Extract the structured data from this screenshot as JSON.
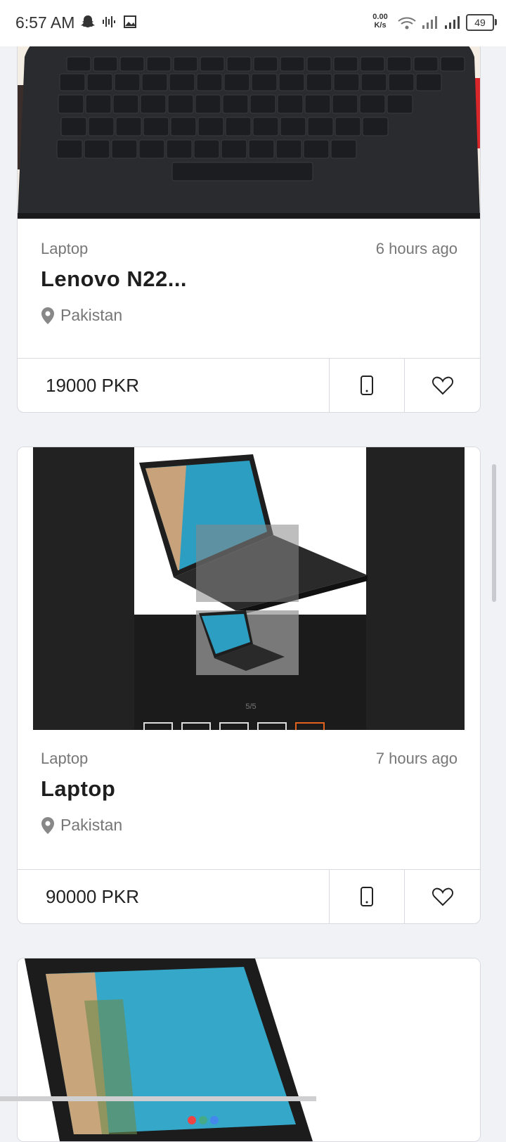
{
  "status_bar": {
    "time": "6:57 AM",
    "net_speed_value": "0.00",
    "net_speed_unit": "K/s",
    "battery": "49"
  },
  "listings": [
    {
      "category": "Laptop",
      "posted": "6 hours ago",
      "title": "Lenovo N22...",
      "location": "Pakistan",
      "price": "19000 PKR"
    },
    {
      "category": "Laptop",
      "posted": "7 hours ago",
      "title": "Laptop",
      "location": "Pakistan",
      "price": "90000 PKR",
      "image_counter": "5/5"
    },
    {
      "category": "",
      "posted": "",
      "title": "",
      "location": "",
      "price": ""
    }
  ],
  "icons": {
    "location": "map-pin-icon",
    "call": "mobile-phone-icon",
    "favorite": "heart-outline-icon"
  },
  "colors": {
    "background": "#f1f2f6",
    "card_border": "#d9dae0",
    "muted_text": "#777777"
  }
}
